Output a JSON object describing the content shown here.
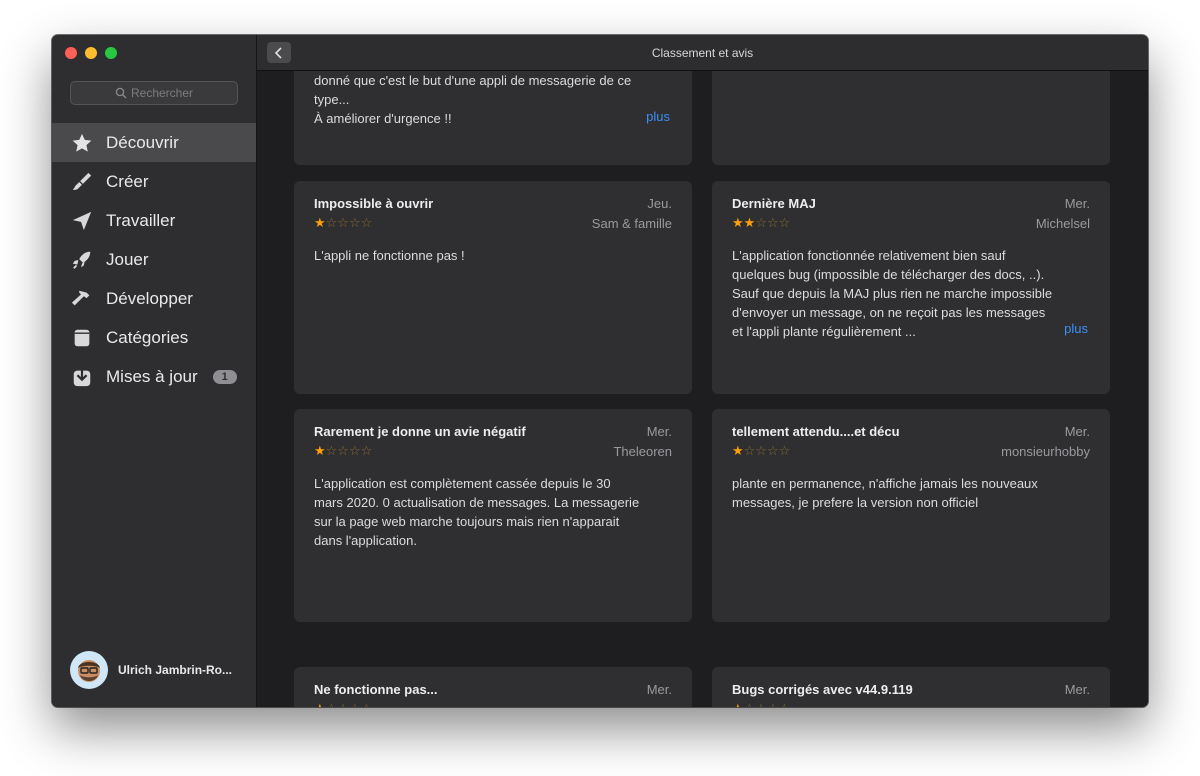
{
  "window": {
    "title": "Classement et avis"
  },
  "search": {
    "placeholder": "Rechercher"
  },
  "sidebar": {
    "items": [
      {
        "label": "Découvrir",
        "icon": "star-icon",
        "active": true
      },
      {
        "label": "Créer",
        "icon": "brush-icon"
      },
      {
        "label": "Travailler",
        "icon": "paperplane-icon"
      },
      {
        "label": "Jouer",
        "icon": "rocket-icon"
      },
      {
        "label": "Développer",
        "icon": "hammer-icon"
      },
      {
        "label": "Catégories",
        "icon": "categories-icon"
      },
      {
        "label": "Mises à jour",
        "icon": "download-icon",
        "badge": "1"
      }
    ]
  },
  "user": {
    "name": "Ulrich Jambrin-Ro..."
  },
  "reviews": [
    {
      "id": "top-left",
      "title": "",
      "date": "",
      "author": "",
      "rating": 0,
      "body": [
        "donné que c'est le but d'une appli de messagerie de ce",
        "type...",
        "À améliorer d'urgence !!"
      ],
      "more": "plus"
    },
    {
      "id": "top-right",
      "title": "",
      "date": "",
      "author": "",
      "rating": 0,
      "body": [],
      "more": ""
    },
    {
      "id": "r1",
      "title": "Impossible à ouvrir",
      "date": "Jeu.",
      "author": "Sam & famille",
      "rating": 1,
      "body": [
        "L'appli ne fonctionne pas !"
      ],
      "more": ""
    },
    {
      "id": "r2",
      "title": "Dernière MAJ",
      "date": "Mer.",
      "author": "Michelsel",
      "rating": 2,
      "body": [
        "L'application fonctionnée relativement bien sauf",
        "quelques bug (impossible de télécharger des docs, ..).",
        "Sauf que depuis la MAJ plus rien ne marche impossible",
        "d'envoyer un message, on ne reçoit pas les messages",
        "et l'appli plante régulièrement ..."
      ],
      "more": "plus"
    },
    {
      "id": "r3",
      "title": "Rarement je donne un avie négatif",
      "date": "Mer.",
      "author": "Theleoren",
      "rating": 1,
      "body": [
        "L'application est complètement cassée depuis le 30",
        "mars 2020. 0 actualisation de messages. La messagerie",
        "sur la page web marche toujours mais rien n'apparait",
        "dans l'application."
      ],
      "more": ""
    },
    {
      "id": "r4",
      "title": "tellement attendu....et décu",
      "date": "Mer.",
      "author": "monsieurhobby",
      "rating": 1,
      "body": [
        "plante en permanence, n'affiche jamais les nouveaux",
        "messages, je prefere la version non officiel"
      ],
      "more": ""
    },
    {
      "id": "r5",
      "title": "Ne fonctionne pas...",
      "date": "Mer.",
      "author": "",
      "rating": 1,
      "body": [],
      "more": ""
    },
    {
      "id": "r6",
      "title": "Bugs corrigés avec v44.9.119",
      "date": "Mer.",
      "author": "",
      "rating": 1,
      "body": [],
      "more": ""
    }
  ],
  "colors": {
    "accent": "#3b8ff6",
    "star": "#ff9f0a",
    "sidebar_bg": "#2e2e30",
    "card_bg": "#2f2f31"
  }
}
